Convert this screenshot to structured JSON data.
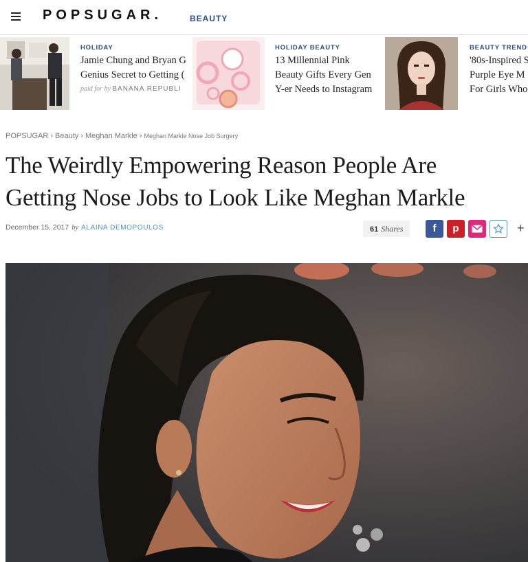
{
  "header": {
    "logo": "POPSUGAR.",
    "section": "BEAUTY"
  },
  "promos": [
    {
      "kicker": "HOLIDAY",
      "line1": "Jamie Chung and Bryan G",
      "line2": "Genius Secret to Getting (",
      "paid_prefix": "paid for by",
      "paid_sponsor": "BANANA REPUBLI"
    },
    {
      "kicker": "HOLIDAY BEAUTY",
      "line1": "13 Millennial Pink",
      "line2": "Beauty Gifts Every Gen",
      "line3": "Y-er Needs to Instagram"
    },
    {
      "kicker": "BEAUTY TREND",
      "line1": "'80s-Inspired S",
      "line2": "Purple Eye M",
      "line3": "For Girls Who"
    }
  ],
  "breadcrumb": {
    "items": [
      "POPSUGAR",
      "Beauty",
      "Meghan Markle"
    ],
    "current": "Meghan Markle Nose Job Surgery",
    "separator": "›"
  },
  "article": {
    "title_line1": "The Weirdly Empowering Reason People Are",
    "title_line2": "Getting Nose Jobs to Look Like Meghan Markle",
    "date": "December 15, 2017",
    "by": "by",
    "author": "ALAINA DEMOPOULOS",
    "shares_count": "61",
    "shares_label": "Shares"
  },
  "share": {
    "facebook": "f",
    "pinterest": "p",
    "more": "+"
  },
  "colors": {
    "brand_blue": "#2a4d8f",
    "facebook": "#3b5998",
    "pinterest": "#cb2027",
    "email": "#e0287a"
  }
}
